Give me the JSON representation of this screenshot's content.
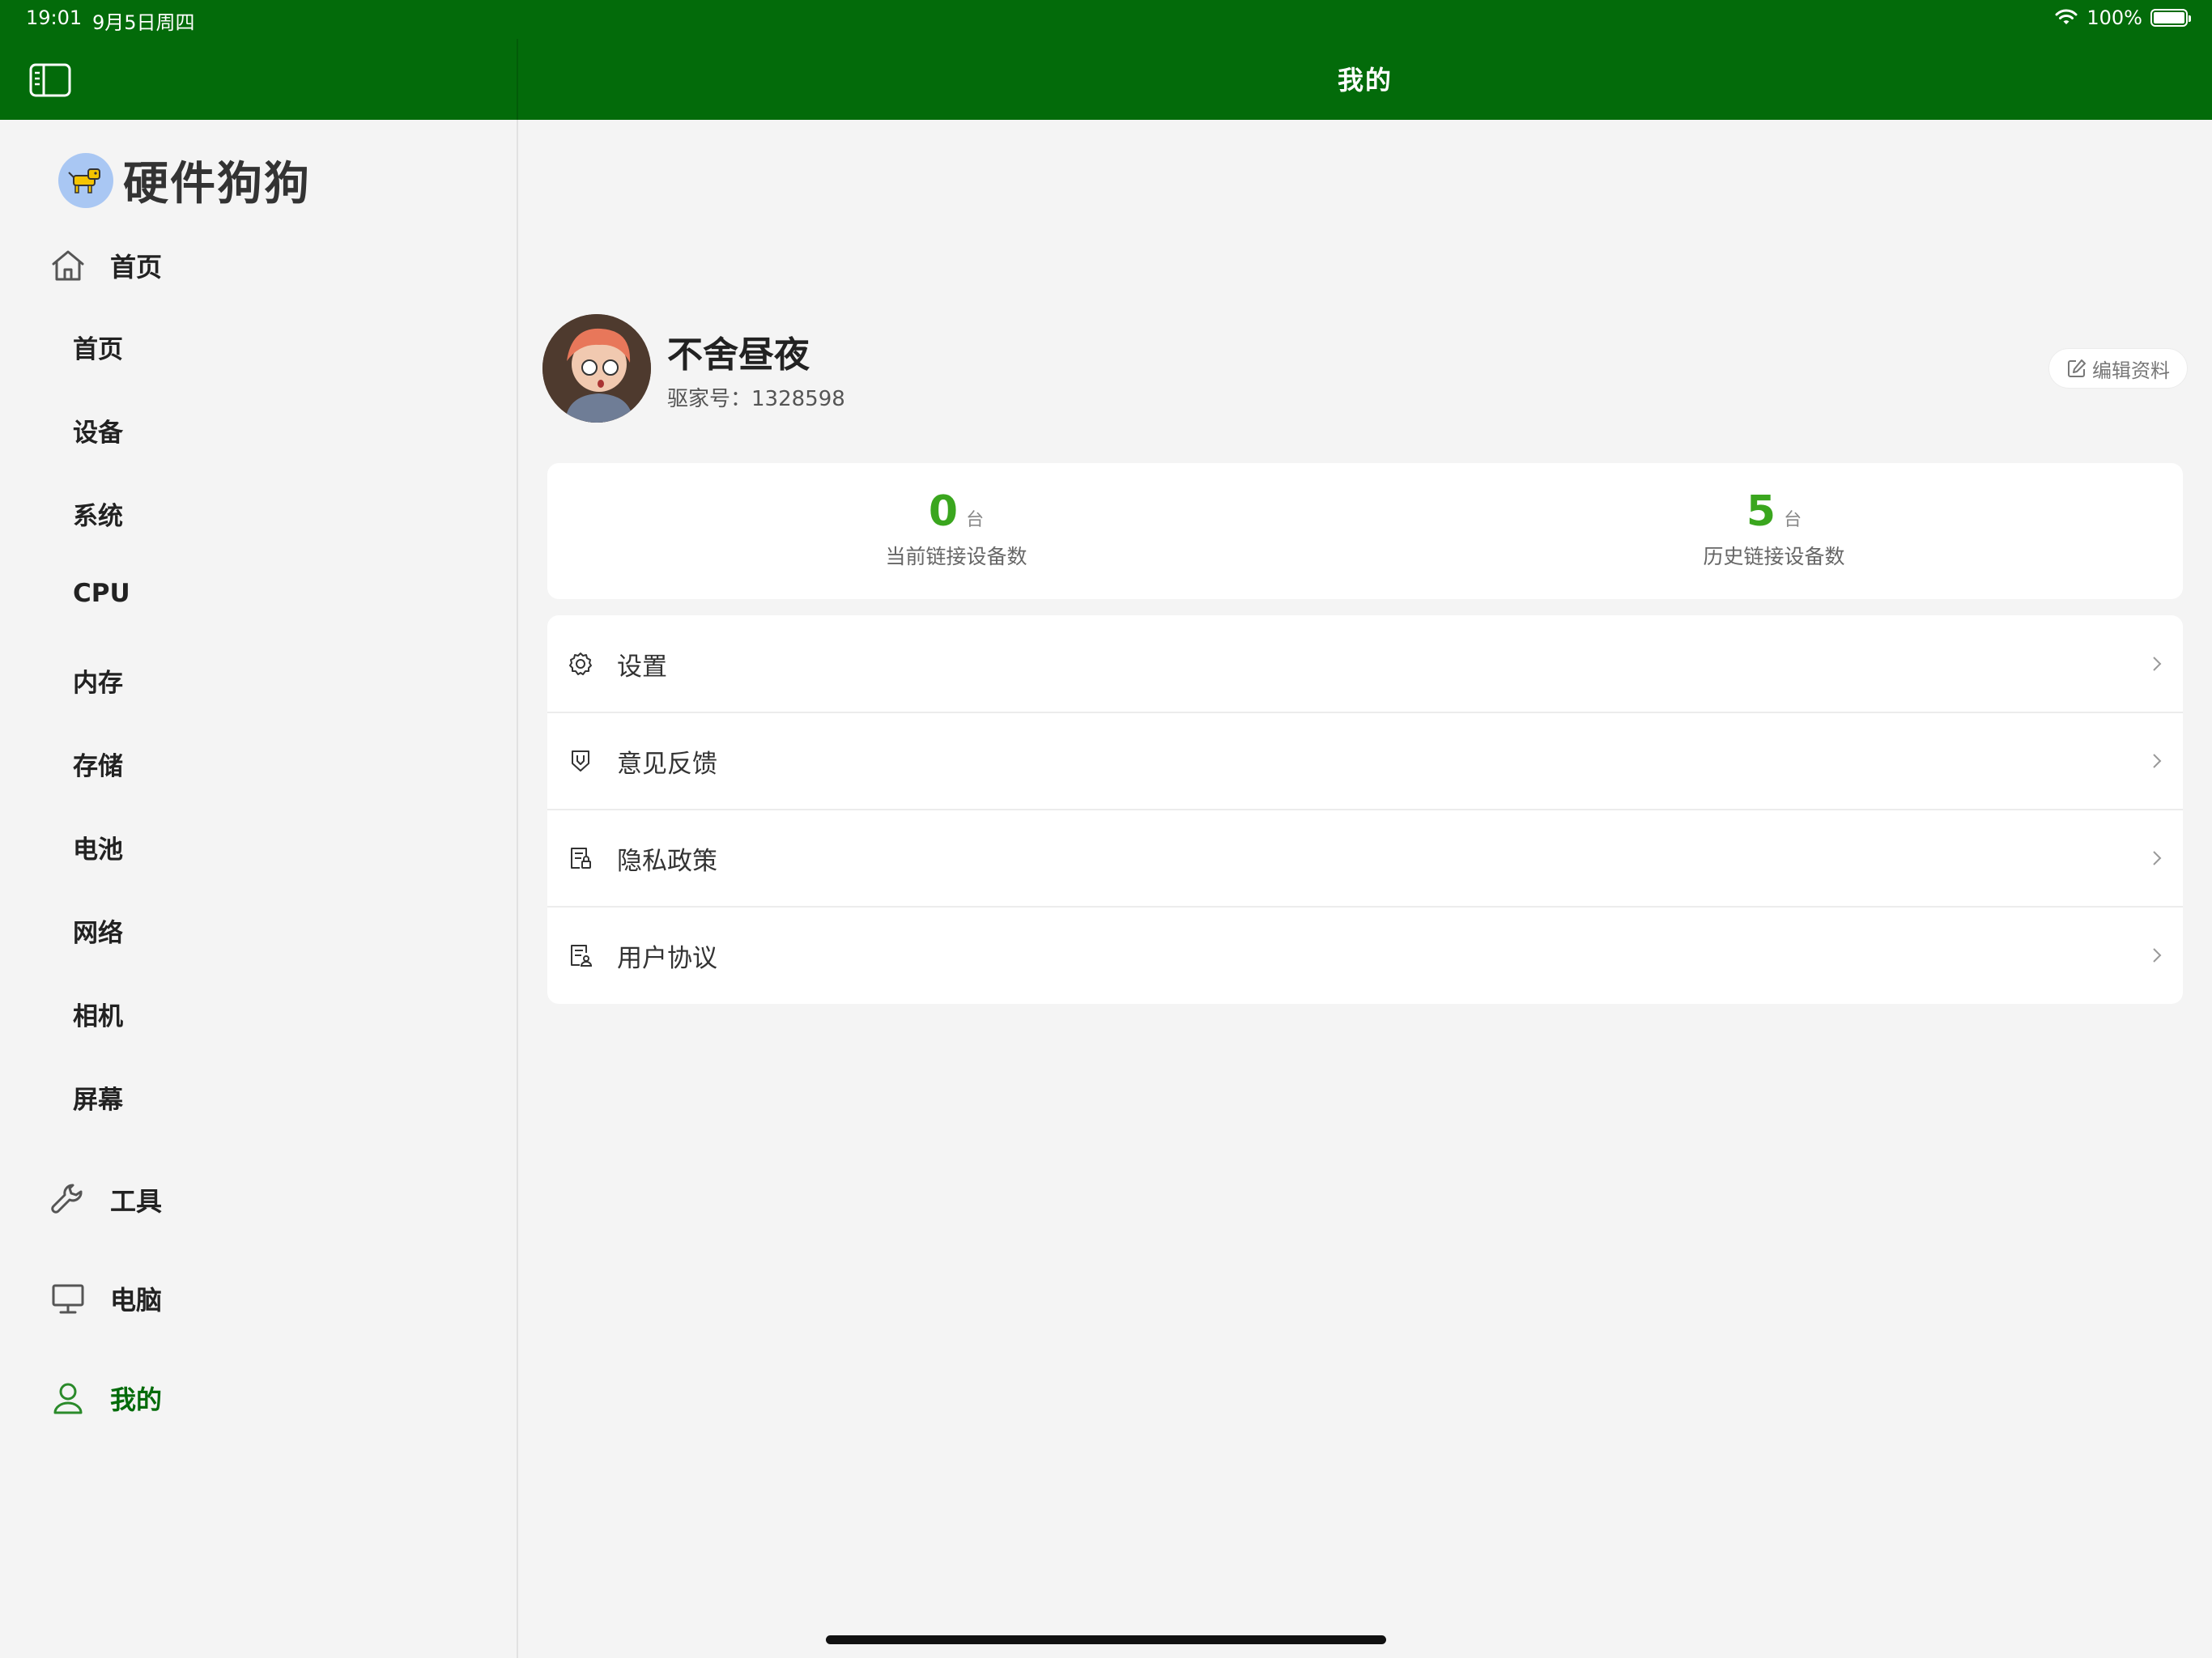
{
  "status_bar": {
    "time": "19:01",
    "date": "9月5日周四",
    "battery_text": "100%",
    "battery_level": 1.0
  },
  "nav": {
    "title": "我的"
  },
  "colors": {
    "nav_bg": "#036b0a",
    "accent_green": "#3aa61e",
    "active_text": "#036b0a"
  },
  "sidebar": {
    "app_name": "硬件狗狗",
    "home_section": {
      "label": "首页",
      "icon": "home-icon"
    },
    "sub_items": [
      {
        "label": "首页"
      },
      {
        "label": "设备"
      },
      {
        "label": "系统"
      },
      {
        "label": "CPU"
      },
      {
        "label": "内存"
      },
      {
        "label": "存储"
      },
      {
        "label": "电池"
      },
      {
        "label": "网络"
      },
      {
        "label": "相机"
      },
      {
        "label": "屏幕"
      }
    ],
    "tools_section": {
      "label": "工具",
      "icon": "wrench-icon"
    },
    "computer_section": {
      "label": "电脑",
      "icon": "monitor-icon"
    },
    "mine_section": {
      "label": "我的",
      "icon": "user-icon",
      "active": true
    }
  },
  "profile": {
    "username": "不舍昼夜",
    "user_id_text": "驱家号：1328598",
    "edit_label": "编辑资料"
  },
  "stats": [
    {
      "value": "0",
      "unit": "台",
      "label": "当前链接设备数"
    },
    {
      "value": "5",
      "unit": "台",
      "label": "历史链接设备数"
    }
  ],
  "menu": [
    {
      "label": "设置",
      "icon": "gear-icon"
    },
    {
      "label": "意见反馈",
      "icon": "feedback-icon"
    },
    {
      "label": "隐私政策",
      "icon": "privacy-document-icon"
    },
    {
      "label": "用户协议",
      "icon": "agreement-document-icon"
    }
  ]
}
